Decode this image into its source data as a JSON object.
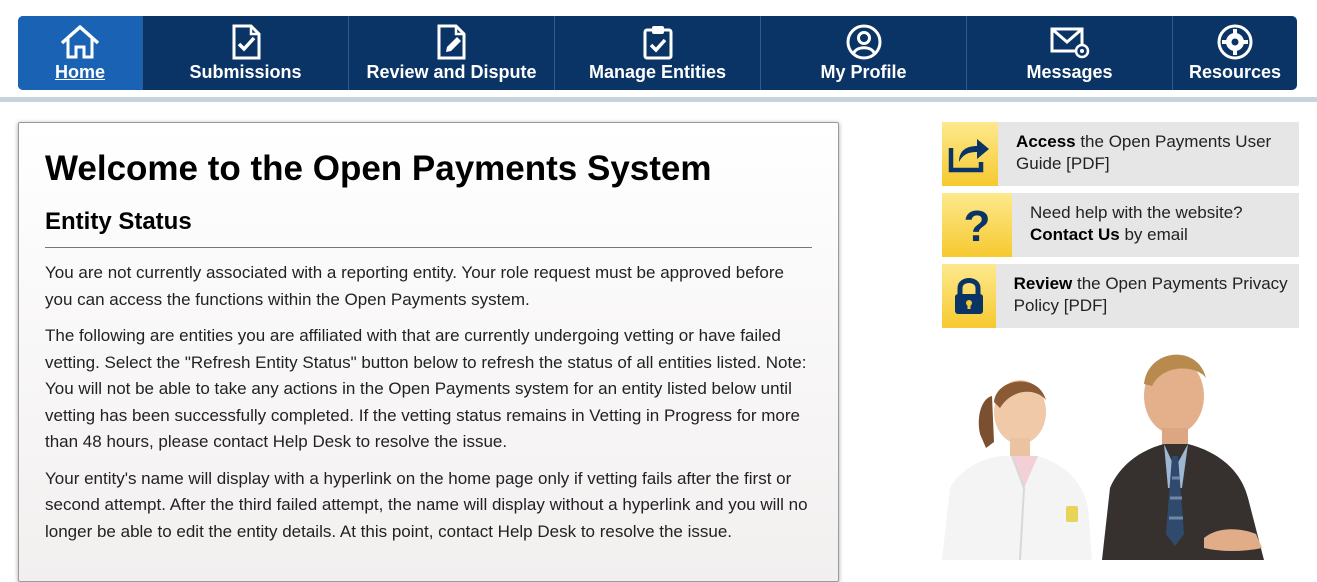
{
  "nav": {
    "items": [
      {
        "label": "Home",
        "icon": "home-icon",
        "active": true
      },
      {
        "label": "Submissions",
        "icon": "checked-document-icon"
      },
      {
        "label": "Review and Dispute",
        "icon": "edit-document-icon"
      },
      {
        "label": "Manage Entities",
        "icon": "clipboard-check-icon"
      },
      {
        "label": "My Profile",
        "icon": "user-circle-icon"
      },
      {
        "label": "Messages",
        "icon": "envelope-icon"
      },
      {
        "label": "Resources",
        "icon": "gear-icon"
      }
    ]
  },
  "welcome": {
    "title": "Welcome to the Open Payments System",
    "section_title": "Entity Status",
    "paragraphs": [
      "You are not currently associated with a reporting entity. Your role request must be approved before you can access the functions within the Open Payments system.",
      "The following are entities you are affiliated with that are currently undergoing vetting or have failed vetting. Select the \"Refresh Entity Status\" button below to refresh the status of all entities listed. Note: You will not be able to take any actions in the Open Payments system for an entity listed below until vetting has been successfully completed. If the vetting status remains in Vetting in Progress for more than 48 hours, please contact Help Desk to resolve the issue.",
      "Your entity's name will display with a hyperlink on the home page only if vetting fails after the first or second attempt. After the third failed attempt, the name will display without a hyperlink and you will no longer be able to edit the entity details. At this point, contact Help Desk to resolve the issue."
    ]
  },
  "side_links": [
    {
      "icon": "share-arrow-icon",
      "bold": "Access",
      "rest": " the Open Payments User Guide [PDF]"
    },
    {
      "icon": "question-mark-icon",
      "pre": "Need help with the website? ",
      "bold": "Contact Us",
      "rest": " by email"
    },
    {
      "icon": "lock-icon",
      "bold": "Review",
      "rest": " the Open Payments Privacy Policy [PDF]"
    }
  ],
  "colors": {
    "nav_bg": "#0b3466",
    "nav_active": "#1a63b4",
    "icon_yellow": "#f6c92f",
    "icon_navy": "#0b3466"
  }
}
